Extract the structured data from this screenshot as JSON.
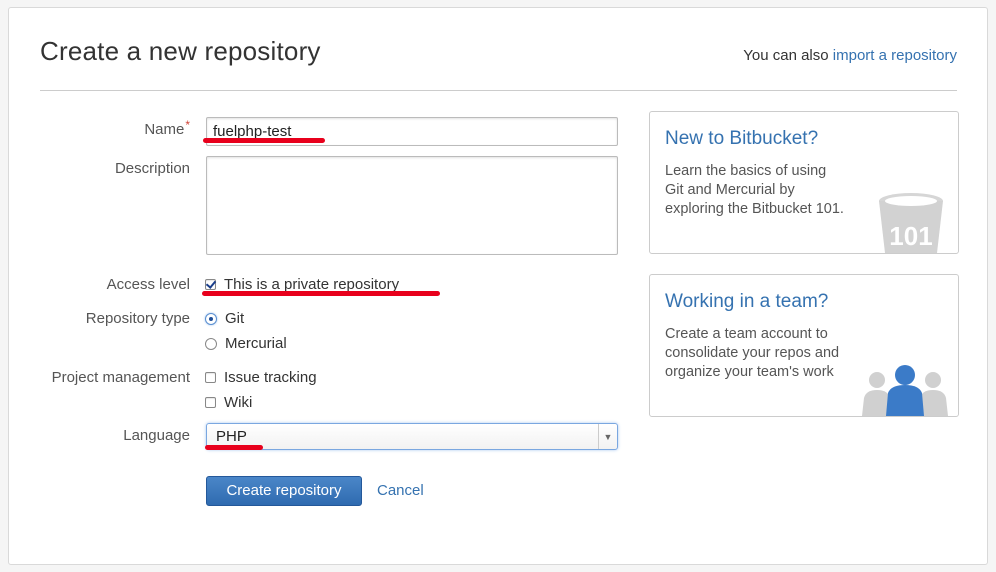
{
  "page": {
    "title": "Create a new repository",
    "import_prefix": "You can also",
    "import_link": "import a repository"
  },
  "form": {
    "name_label": "Name",
    "name_required_mark": "*",
    "name_value": "fuelphp-test",
    "description_label": "Description",
    "description_value": "",
    "access_label": "Access level",
    "private_label": "This is a private repository",
    "private_checked": true,
    "repo_type_label": "Repository type",
    "repo_types": [
      {
        "label": "Git",
        "selected": true
      },
      {
        "label": "Mercurial",
        "selected": false
      }
    ],
    "project_mgmt_label": "Project management",
    "project_options": [
      {
        "label": "Issue tracking",
        "checked": false
      },
      {
        "label": "Wiki",
        "checked": false
      }
    ],
    "language_label": "Language",
    "language_value": "PHP",
    "submit_label": "Create repository",
    "cancel_label": "Cancel"
  },
  "sidebar": {
    "card1": {
      "title": "New to Bitbucket?",
      "body": "Learn the basics of using Git and Mercurial by exploring the Bitbucket 101.",
      "icon_text": "101"
    },
    "card2": {
      "title": "Working in a team?",
      "body": "Create a team account to consolidate your repos and organize your team's work"
    }
  },
  "colors": {
    "link": "#3572b0",
    "primary_button": "#3a78bf",
    "annotation_underline": "#e8001c",
    "required": "#d04437"
  }
}
